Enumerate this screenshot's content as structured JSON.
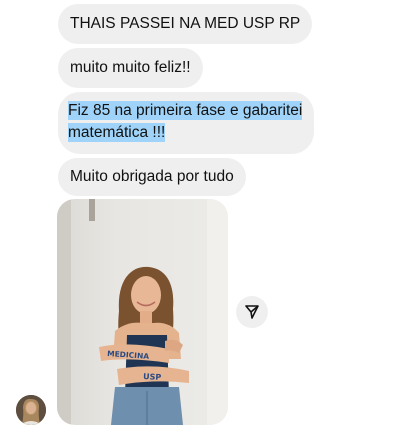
{
  "messages": [
    {
      "text": "THAIS PASSEI NA MED USP RP"
    },
    {
      "text": "muito muito feliz!!"
    },
    {
      "lines": [
        "Fiz 85 na primeira fase e gabaritei",
        "matemática !!!"
      ],
      "highlighted": true
    },
    {
      "text": "Muito obrigada por tudo"
    }
  ],
  "photo": {
    "arm_text_left": "MEDICINA",
    "arm_text_right": "USP"
  },
  "icons": {
    "share": "share-icon",
    "avatar": "avatar"
  },
  "colors": {
    "bubble": "#efefef",
    "highlight": "#9fd3f9",
    "text": "#111111"
  }
}
